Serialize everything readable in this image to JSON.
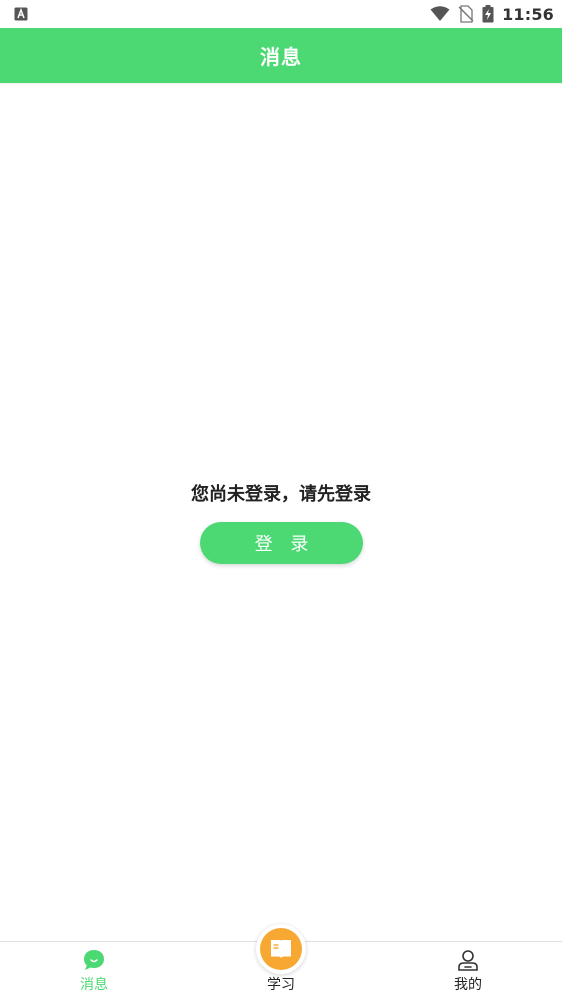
{
  "status_bar": {
    "time": "11:56",
    "left_icon": "a-box-icon",
    "right_icons": [
      "wifi-icon",
      "no-sim-icon",
      "battery-charging-icon"
    ]
  },
  "header": {
    "title": "消息"
  },
  "main": {
    "prompt": "您尚未登录，请先登录",
    "login_button_label": "登 录"
  },
  "tab_bar": {
    "tabs": [
      {
        "label": "消息",
        "icon": "chat-bubble-icon",
        "active": true
      },
      {
        "label": "学习",
        "icon": "book-icon",
        "active": false
      },
      {
        "label": "我的",
        "icon": "user-icon",
        "active": false
      }
    ]
  },
  "colors": {
    "accent": "#4cd973",
    "fab": "#f7a833",
    "text_dark": "#222222"
  }
}
